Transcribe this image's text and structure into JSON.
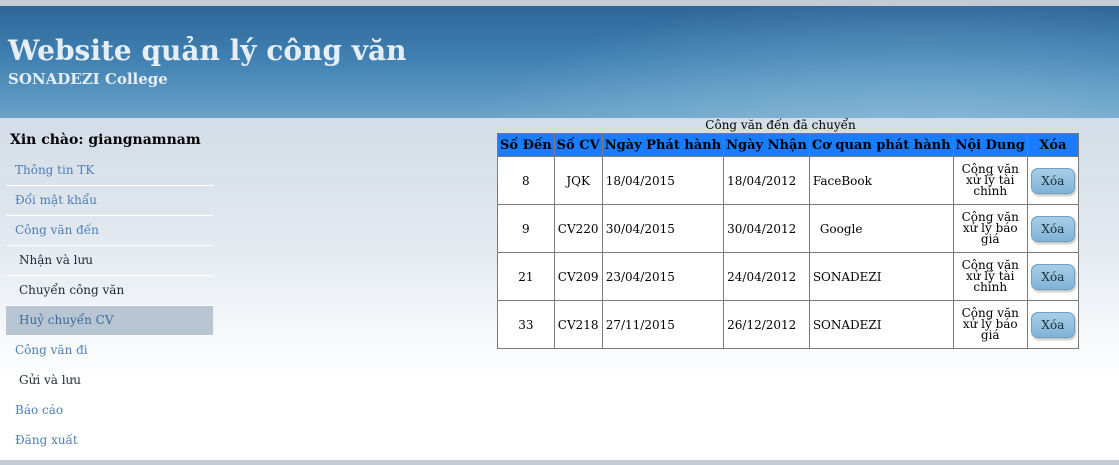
{
  "header": {
    "title": "Website quản lý công văn",
    "subtitle": "SONADEZI College"
  },
  "sidebar": {
    "greeting": "Xin chào: giangnamnam",
    "items": [
      {
        "label": "Thông tin TK",
        "level": "top"
      },
      {
        "label": "Đổi mật khẩu",
        "level": "top"
      },
      {
        "label": "Công văn đến",
        "level": "top"
      },
      {
        "label": "Nhận và lưu",
        "level": "sub"
      },
      {
        "label": "Chuyển công văn",
        "level": "sub"
      },
      {
        "label": "Huỷ chuyển CV",
        "level": "sub",
        "active": true
      },
      {
        "label": "Công văn đi",
        "level": "top"
      },
      {
        "label": "Gửi và lưu",
        "level": "sub"
      },
      {
        "label": "Báo cáo",
        "level": "top"
      },
      {
        "label": "Đăng xuất",
        "level": "top"
      }
    ]
  },
  "main": {
    "caption": "Công văn đến đã chuyển",
    "columns": [
      "Số Đến",
      "Số CV",
      "Ngày Phát hành",
      "Ngày Nhận",
      "Cơ quan phát hành",
      "Nội Dung",
      "Xóa"
    ],
    "rows": [
      {
        "so_den": "8",
        "so_cv": "JQK",
        "ngay_ph": "18/04/2015",
        "ngay_nhan": "18/04/2012",
        "co_quan": "FaceBook",
        "noi_dung": [
          "Công văn",
          "xử lý tài",
          "chính"
        ],
        "xoa": "Xóa"
      },
      {
        "so_den": "9",
        "so_cv": "CV220",
        "ngay_ph": "30/04/2015",
        "ngay_nhan": "30/04/2012",
        "co_quan": "Google",
        "noi_dung": [
          "Công văn",
          "xử lý báo",
          "giá"
        ],
        "xoa": "Xóa"
      },
      {
        "so_den": "21",
        "so_cv": "CV209",
        "ngay_ph": "23/04/2015",
        "ngay_nhan": "24/04/2012",
        "co_quan": "SONADEZI",
        "noi_dung": [
          "Công văn",
          "xử lý tài",
          "chính"
        ],
        "xoa": "Xóa"
      },
      {
        "so_den": "33",
        "so_cv": "CV218",
        "ngay_ph": "27/11/2015",
        "ngay_nhan": "26/12/2012",
        "co_quan": "SONADEZI",
        "noi_dung": [
          "Công văn",
          "xử lý báo",
          "giá"
        ],
        "xoa": "Xóa"
      }
    ]
  },
  "colors": {
    "header_blue": "#3f7fb1",
    "table_header": "#1a7cff",
    "menu_active": "#b8c5d3",
    "button": "#8fbfdd"
  }
}
